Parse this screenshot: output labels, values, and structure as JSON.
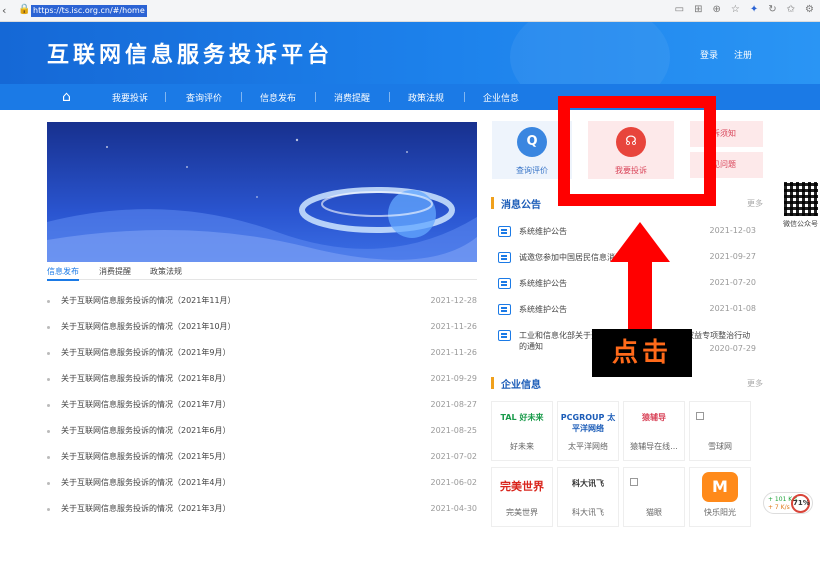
{
  "browser": {
    "back_icon": "back-arrow-icon",
    "lock_icon": "lock-icon",
    "url": "https://ts.isc.org.cn/#/home"
  },
  "header": {
    "site_title": "互联网信息服务投诉平台",
    "login": "登录",
    "register": "注册"
  },
  "nav": {
    "home_icon": "home-icon",
    "items": [
      "我要投诉",
      "查询评价",
      "信息发布",
      "消费提醒",
      "政策法规",
      "企业信息"
    ]
  },
  "left_tabs": [
    "信息发布",
    "消费提醒",
    "政策法规"
  ],
  "news": [
    {
      "title": "关于互联网信息服务投诉的情况（2021年11月）",
      "date": "2021-12-28"
    },
    {
      "title": "关于互联网信息服务投诉的情况（2021年10月）",
      "date": "2021-11-26"
    },
    {
      "title": "关于互联网信息服务投诉的情况（2021年9月）",
      "date": "2021-11-26"
    },
    {
      "title": "关于互联网信息服务投诉的情况（2021年8月）",
      "date": "2021-09-29"
    },
    {
      "title": "关于互联网信息服务投诉的情况（2021年7月）",
      "date": "2021-08-27"
    },
    {
      "title": "关于互联网信息服务投诉的情况（2021年6月）",
      "date": "2021-08-25"
    },
    {
      "title": "关于互联网信息服务投诉的情况（2021年5月）",
      "date": "2021-07-02"
    },
    {
      "title": "关于互联网信息服务投诉的情况（2021年4月）",
      "date": "2021-06-02"
    },
    {
      "title": "关于互联网信息服务投诉的情况（2021年3月）",
      "date": "2021-04-30"
    }
  ],
  "services": {
    "query": "查询评价",
    "complain": "我要投诉",
    "notice_partial": "投诉须知",
    "faq_partial": "常见问题"
  },
  "notices_section": {
    "title": "消息公告",
    "more": "更多"
  },
  "notices": [
    {
      "title": "系统维护公告",
      "date": "2021-12-03"
    },
    {
      "title": "诚邀您参加中国居民信息消费问卷",
      "date": "2021-09-27"
    },
    {
      "title": "系统维护公告",
      "date": "2021-07-20"
    },
    {
      "title": "系统维护公告",
      "date": "2021-01-08"
    },
    {
      "title": "工业和信息化部关于开展纵深推进APP侵害用户权益专项整治行动的通知",
      "date": "2020-07-29"
    }
  ],
  "companies_section": {
    "title": "企业信息",
    "more": "更多"
  },
  "companies": [
    {
      "logo": "TAL 好未来",
      "name": "好未来",
      "color": "#1a9b4b"
    },
    {
      "logo": "PCGROUP 太平洋网络",
      "name": "太平洋网络",
      "color": "#1b5cb8"
    },
    {
      "logo": "猿辅导",
      "name": "猿辅导在线...",
      "color": "#d9455a"
    },
    {
      "logo": "",
      "name": "雪球网",
      "color": "#999999"
    },
    {
      "logo": "完美世界",
      "name": "完美世界",
      "color": "#d9251c"
    },
    {
      "logo": "科大讯飞",
      "name": "科大讯飞",
      "color": "#333333"
    },
    {
      "logo": "",
      "name": "猫眼",
      "color": "#999999"
    },
    {
      "logo": "",
      "name": "快乐阳光",
      "color": "#ff8a1a"
    }
  ],
  "qr_label": "微信公众号",
  "annotation": {
    "click_label": "点击"
  },
  "speed_widget": {
    "up": "+ 101 K/s",
    "down": "+ 7 K/s",
    "percent": "71%"
  },
  "colors": {
    "primary": "#1b7ae6",
    "accent_orange": "#f0a01c",
    "annotation_red": "#ff0000"
  }
}
